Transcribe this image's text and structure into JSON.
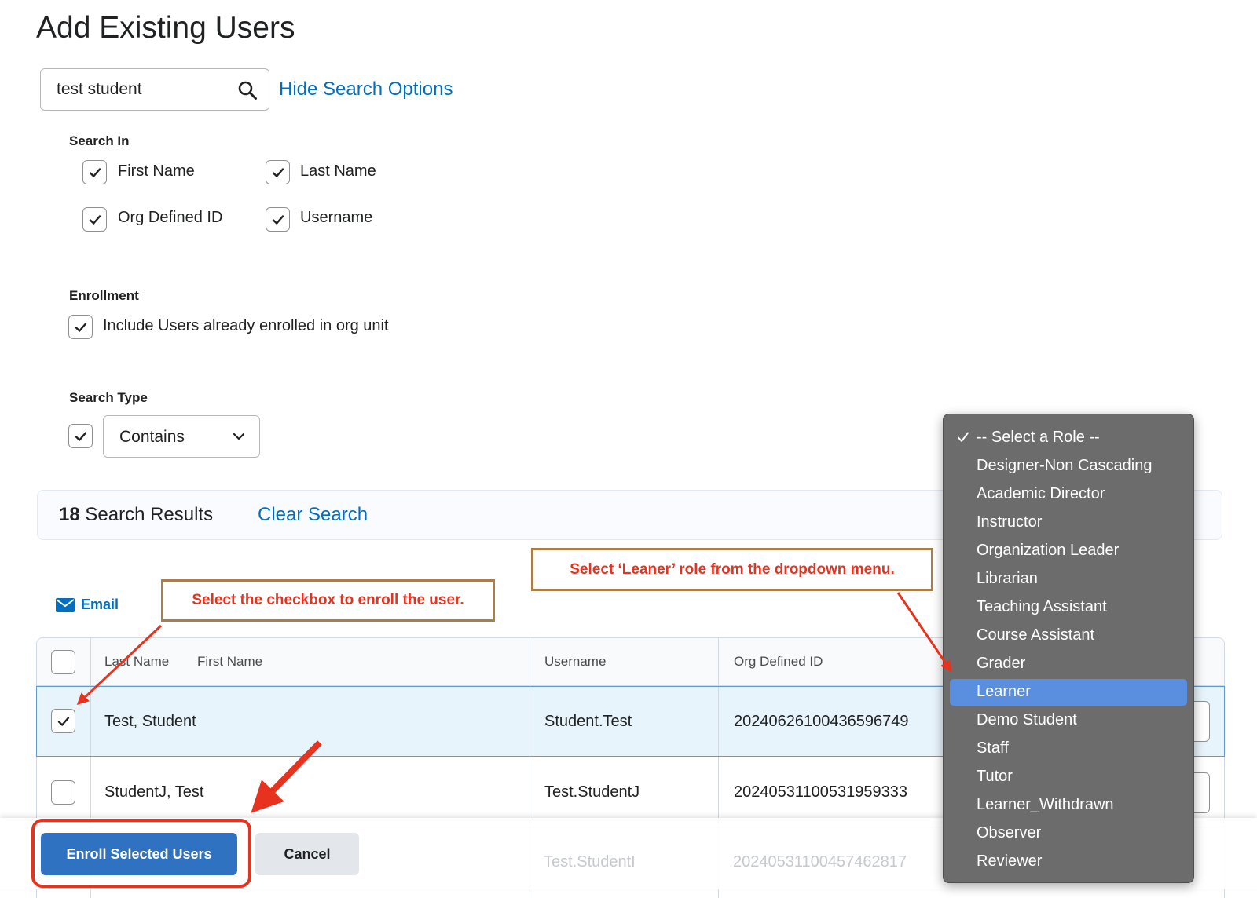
{
  "page": {
    "title": "Add Existing Users"
  },
  "search": {
    "value": "test student",
    "hide_options_label": "Hide Search Options"
  },
  "search_in": {
    "label": "Search In",
    "options": [
      {
        "label": "First Name",
        "checked": true
      },
      {
        "label": "Last Name",
        "checked": true
      },
      {
        "label": "Org Defined ID",
        "checked": true
      },
      {
        "label": "Username",
        "checked": true
      }
    ]
  },
  "enrollment": {
    "label": "Enrollment",
    "option": "Include Users already enrolled in org unit",
    "checked": true
  },
  "search_type": {
    "label": "Search Type",
    "checked": true,
    "selected": "Contains"
  },
  "results": {
    "count": "18",
    "label": "Search Results",
    "clear_label": "Clear Search"
  },
  "actions": {
    "email_label": "Email"
  },
  "table": {
    "headers": {
      "last_name": "Last Name",
      "first_name": "First Name",
      "username": "Username",
      "org_defined_id": "Org Defined ID"
    },
    "rows": [
      {
        "name": "Test, Student",
        "username": "Student.Test",
        "org_id": "20240626100436596749",
        "selected": true
      },
      {
        "name": "StudentJ, Test",
        "username": "Test.StudentJ",
        "org_id": "20240531100531959333",
        "selected": false
      },
      {
        "name": "",
        "username": "Test.StudentI",
        "org_id": "20240531100457462817",
        "selected": false
      }
    ]
  },
  "footer": {
    "enroll_label": "Enroll Selected Users",
    "cancel_label": "Cancel"
  },
  "role_dropdown": {
    "items": [
      "-- Select a Role --",
      "Designer-Non Cascading",
      "Academic Director",
      "Instructor",
      "Organization Leader",
      "Librarian",
      "Teaching Assistant",
      "Course Assistant",
      "Grader",
      "Learner",
      "Demo Student",
      "Staff",
      "Tutor",
      "Learner_Withdrawn",
      "Observer",
      "Reviewer"
    ],
    "checked_item": "-- Select a Role --",
    "highlighted_item": "Learner"
  },
  "annotations": {
    "checkbox_callout": "Select the checkbox to enroll the user.",
    "role_callout": "Select ‘Leaner’ role from the dropdown menu."
  },
  "colors": {
    "link": "#006fbf",
    "primary_button": "#2f72c1",
    "annotation_red": "#e6321e",
    "dropdown_bg": "#6c6c6c",
    "dropdown_highlight": "#5a8fe0"
  }
}
